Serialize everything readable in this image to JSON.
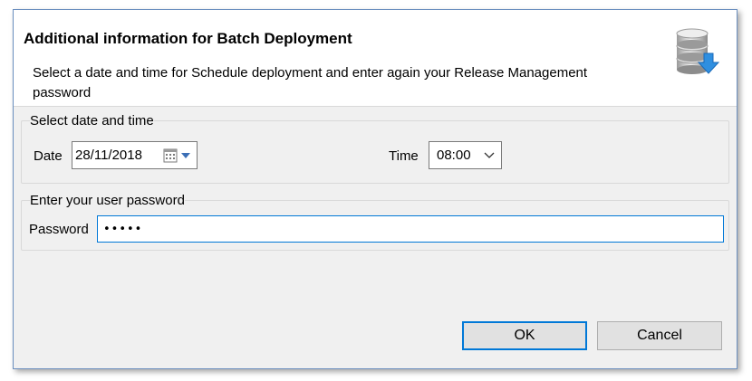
{
  "dialog": {
    "title": "Additional information for Batch Deployment",
    "description": "Select a date and time for Schedule deployment and enter again your Release Management password",
    "icon": "database-download-icon"
  },
  "schedule_group": {
    "label": "Select date and time",
    "date_label": "Date",
    "date_value": "28/11/2018",
    "time_label": "Time",
    "time_value": "08:00"
  },
  "password_group": {
    "label": "Enter your user password",
    "password_label": "Password",
    "password_value": "•••••"
  },
  "buttons": {
    "ok": "OK",
    "cancel": "Cancel"
  },
  "colors": {
    "accent": "#0078d7",
    "window_border": "#6b8fbf",
    "panel_bg": "#f0f0f0"
  }
}
